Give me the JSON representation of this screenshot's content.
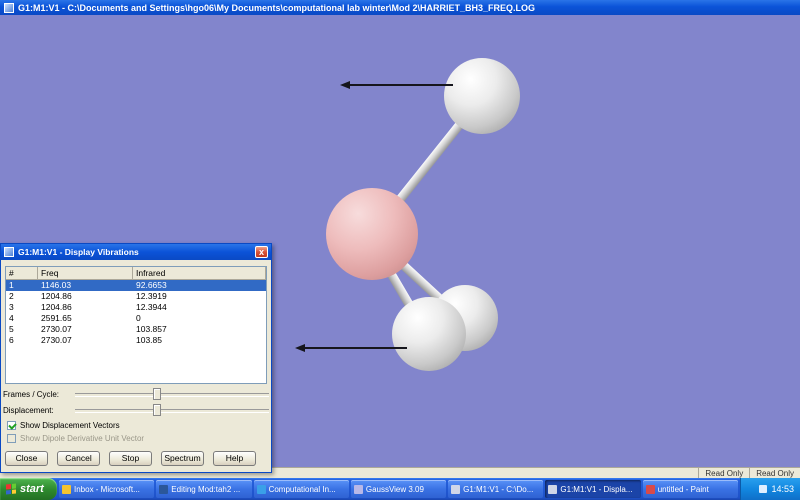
{
  "window": {
    "title": "G1:M1:V1 - C:\\Documents and Settings\\hgo06\\My Documents\\computational lab winter\\Mod 2\\HARRIET_BH3_FREQ.LOG"
  },
  "statusbar": {
    "left": "Read Only",
    "right": "Read Only"
  },
  "dialog": {
    "title": "G1:M1:V1 - Display Vibrations",
    "close_glyph": "x",
    "table": {
      "columns": [
        "#",
        "Freq",
        "Infrared"
      ],
      "rows": [
        {
          "num": "1",
          "freq": "1146.03",
          "infrared": "92.6653"
        },
        {
          "num": "2",
          "freq": "1204.86",
          "infrared": "12.3919"
        },
        {
          "num": "3",
          "freq": "1204.86",
          "infrared": "12.3944"
        },
        {
          "num": "4",
          "freq": "2591.65",
          "infrared": "0"
        },
        {
          "num": "5",
          "freq": "2730.07",
          "infrared": "103.857"
        },
        {
          "num": "6",
          "freq": "2730.07",
          "infrared": "103.85"
        }
      ]
    },
    "frames_label": "Frames / Cycle:",
    "displacement_label": "Displacement:",
    "checkbox_vectors": "Show Displacement Vectors",
    "checkbox_dipole": "Show Dipole Derivative Unit Vector",
    "buttons": [
      "Close",
      "Cancel",
      "Stop",
      "Spectrum",
      "Help"
    ]
  },
  "molecule": {
    "atoms": [
      "B",
      "H",
      "H",
      "H"
    ],
    "accent_pink": "#eebcbc",
    "background": "#8285cc"
  },
  "taskbar": {
    "start": "start",
    "items": [
      {
        "label": "Inbox - Microsoft..."
      },
      {
        "label": "Editing Mod:tah2 ..."
      },
      {
        "label": "Computational In..."
      },
      {
        "label": "GaussView 3.09"
      },
      {
        "label": "G1:M1:V1 - C:\\Do..."
      },
      {
        "label": "G1:M1:V1 - Displa..."
      },
      {
        "label": "untitled - Paint"
      }
    ],
    "clock": "14:53"
  }
}
